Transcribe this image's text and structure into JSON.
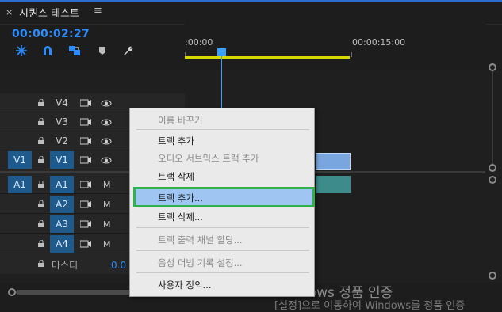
{
  "header": {
    "close_glyph": "×",
    "sequence_title": "시퀀스 테스트",
    "menu_glyph": "≡",
    "timecode": "00:00:02:27"
  },
  "toolbar": {
    "tools": [
      "snap-icon",
      "magnet-icon",
      "linked-selection-icon",
      "marker-icon",
      "wrench-icon"
    ]
  },
  "ruler": {
    "start_label": ":00:00",
    "mid_label": "00:00:15:00"
  },
  "tracks": {
    "video": [
      {
        "target": "V4",
        "source": ""
      },
      {
        "target": "V3",
        "source": ""
      },
      {
        "target": "V2",
        "source": ""
      },
      {
        "target": "V1",
        "source": "V1"
      }
    ],
    "audio": [
      {
        "target": "A1",
        "source": "A1",
        "m": "M"
      },
      {
        "target": "A2",
        "source": "",
        "m": "M"
      },
      {
        "target": "A3",
        "source": "",
        "m": "M"
      },
      {
        "target": "A4",
        "source": "",
        "m": "M"
      }
    ],
    "master_label": "마스터",
    "master_value": "0.0"
  },
  "context_menu": {
    "items": [
      {
        "label": "이름 바꾸기",
        "enabled": false
      },
      {
        "label": "트랙 추가",
        "enabled": true
      },
      {
        "label": "오디오 서브믹스 트랙 추가",
        "enabled": false
      },
      {
        "label": "트랙 삭제",
        "enabled": true
      },
      {
        "label": "트랙 추가...",
        "enabled": true,
        "highlighted": true
      },
      {
        "label": "트랙 삭제...",
        "enabled": true
      },
      {
        "label": "트랙 출력 채널 할당...",
        "enabled": false
      },
      {
        "label": "음성 더빙 기록 설정...",
        "enabled": false
      },
      {
        "label": "사용자 정의...",
        "enabled": true
      }
    ]
  },
  "watermark": {
    "line1": "Windows 정품 인증",
    "line2": "[설정]으로 이동하여 Windows를 정품 인증"
  },
  "colors": {
    "accent": "#2b8cff",
    "work_area": "#d8d800",
    "highlight": "#9fc6f2",
    "green_outline": "#2db34a"
  }
}
